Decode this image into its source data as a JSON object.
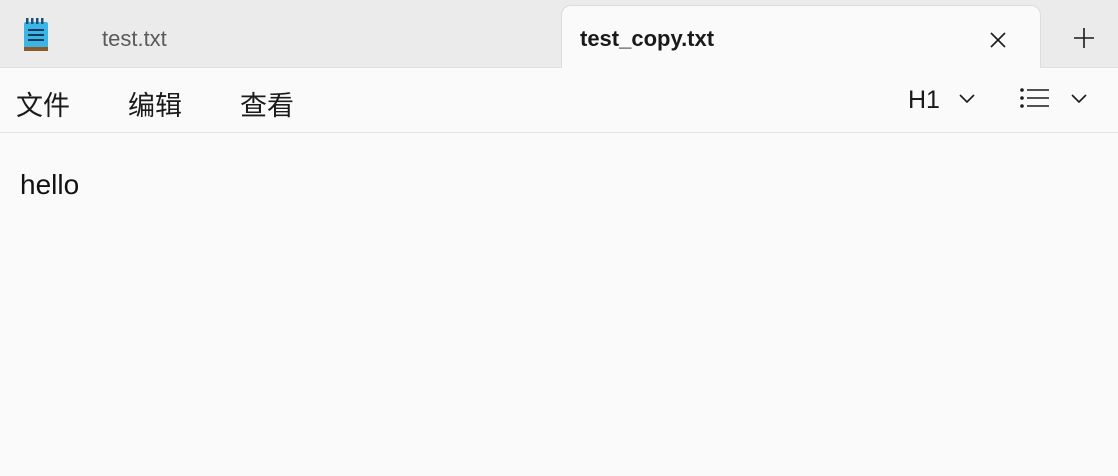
{
  "tabs": [
    {
      "label": "test.txt",
      "active": false
    },
    {
      "label": "test_copy.txt",
      "active": true
    }
  ],
  "tab_icons": {
    "close": "close-icon",
    "new_tab": "plus-icon",
    "app": "notepad-icon"
  },
  "menu": {
    "file": "文件",
    "edit": "编辑",
    "view": "查看"
  },
  "toolbar": {
    "heading_value": "H1",
    "list_icon": "bulleted-list-icon",
    "dropdown_icon": "chevron-down-icon"
  },
  "editor": {
    "content": "hello"
  },
  "colors": {
    "tabbar_bg": "#ebebeb",
    "active_tab_bg": "#fafafa",
    "text": "#1a1a1a",
    "inactive_tab_text": "#5a5a5a",
    "app_icon_accent": "#2aa5d8"
  }
}
